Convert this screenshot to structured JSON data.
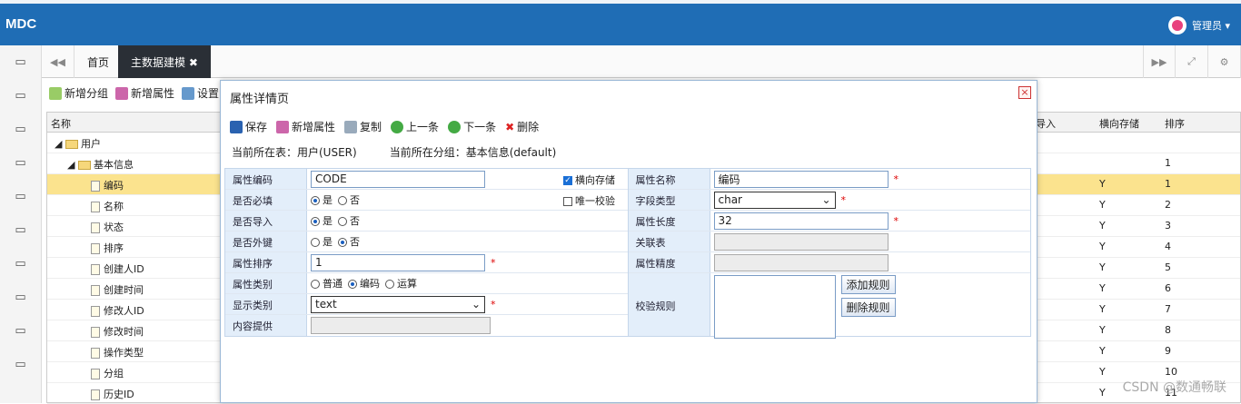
{
  "app": {
    "logo": "MDC",
    "user": "管理员 ▾"
  },
  "tabs": [
    {
      "label": "首页"
    },
    {
      "label": "主数据建模 ✖"
    }
  ],
  "toolbar": {
    "add_group": "新增分组",
    "add_attr": "新增属性",
    "settings": "设置"
  },
  "grid": {
    "headers": {
      "name": "名称",
      "import": "导入",
      "horizontal": "横向存储",
      "order": "排序"
    },
    "rows": [
      {
        "name": "用户",
        "h": "",
        "o": ""
      },
      {
        "name": "基本信息",
        "h": "",
        "o": "1"
      },
      {
        "name": "编码",
        "h": "Y",
        "o": "1"
      },
      {
        "name": "名称",
        "h": "Y",
        "o": "2"
      },
      {
        "name": "状态",
        "h": "Y",
        "o": "3"
      },
      {
        "name": "排序",
        "h": "Y",
        "o": "4"
      },
      {
        "name": "创建人ID",
        "h": "Y",
        "o": "5"
      },
      {
        "name": "创建时间",
        "h": "Y",
        "o": "6"
      },
      {
        "name": "修改人ID",
        "h": "Y",
        "o": "7"
      },
      {
        "name": "修改时间",
        "h": "Y",
        "o": "8"
      },
      {
        "name": "操作类型",
        "h": "Y",
        "o": "9"
      },
      {
        "name": "分组",
        "h": "Y",
        "o": "10"
      },
      {
        "name": "历史ID",
        "h": "Y",
        "o": "11"
      }
    ]
  },
  "dialog": {
    "title": "属性详情页",
    "tools": {
      "save": "保存",
      "add": "新增属性",
      "copy": "复制",
      "prev": "上一条",
      "next": "下一条",
      "delete": "删除"
    },
    "current_table": "当前所在表：用户(USER)",
    "current_group": "当前所在分组：基本信息(default)",
    "labels": {
      "code": "属性编码",
      "required": "是否必填",
      "imp": "是否导入",
      "fk": "是否外键",
      "order": "属性排序",
      "category": "属性类别",
      "display": "显示类别",
      "hint": "内容提供",
      "name": "属性名称",
      "field_type": "字段类型",
      "length": "属性长度",
      "assoc": "关联表",
      "precision": "属性精度",
      "rules": "校验规则"
    },
    "values": {
      "code": "CODE",
      "order": "1",
      "display": "text",
      "name": "编码",
      "field_type": "char",
      "length": "32"
    },
    "options": {
      "yes": "是",
      "no": "否",
      "normal": "普通",
      "encode": "编码",
      "calc": "运算",
      "horizontal": "横向存储",
      "unique": "唯一校验"
    },
    "buttons": {
      "add_rule": "添加规则",
      "del_rule": "删除规则"
    }
  },
  "watermark": "CSDN @数通畅联"
}
